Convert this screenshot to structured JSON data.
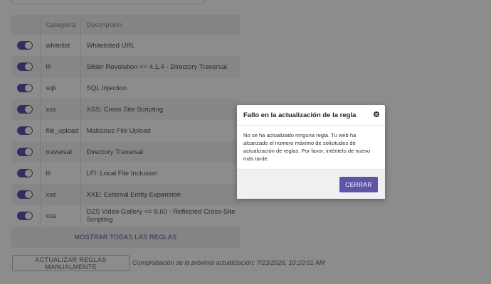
{
  "table": {
    "headers": {
      "toggle": "",
      "category": "Categoría",
      "description": "Descripción"
    },
    "rows": [
      {
        "enabled": true,
        "category": "whitelist",
        "description": "Whitelisted URL"
      },
      {
        "enabled": true,
        "category": "lfi",
        "description": "Slider Revolution <= 4.1.4 - Directory Traversal"
      },
      {
        "enabled": true,
        "category": "sqli",
        "description": "SQL Injection"
      },
      {
        "enabled": true,
        "category": "xss",
        "description": "XSS: Cross Site Scripting"
      },
      {
        "enabled": true,
        "category": "file_upload",
        "description": "Malicious File Upload"
      },
      {
        "enabled": true,
        "category": "traversal",
        "description": "Directory Traversal"
      },
      {
        "enabled": true,
        "category": "lfi",
        "description": "LFI: Local File Inclusion"
      },
      {
        "enabled": true,
        "category": "xxe",
        "description": "XXE: External Entity Expansion"
      },
      {
        "enabled": true,
        "category": "xss",
        "description": "DZS Video Gallery <= 8.60 - Reflected Cross-Site Scripting"
      }
    ],
    "show_all_label": "MOSTRAR TODAS LAS REGLAS"
  },
  "footer": {
    "manual_update_label": "ACTUALIZAR REGLAS MANUALMENTE",
    "next_check_text": "Comprobación de la próxima actualización: 7/23/2026, 10:10:01 AM"
  },
  "modal": {
    "title": "Fallo en la actualización de la regla",
    "body": "No se ha actualizado ninguna regla. Tu web ha alcanzado el número máximo de solicitudes de actualización de reglas. Por favor, inténtelo de nuevo más tarde.",
    "close_label": "CERRAR",
    "close_icon": "close-icon"
  },
  "colors": {
    "accent": "#5f55a8",
    "overlay": "rgba(0,0,0,0.45)"
  }
}
